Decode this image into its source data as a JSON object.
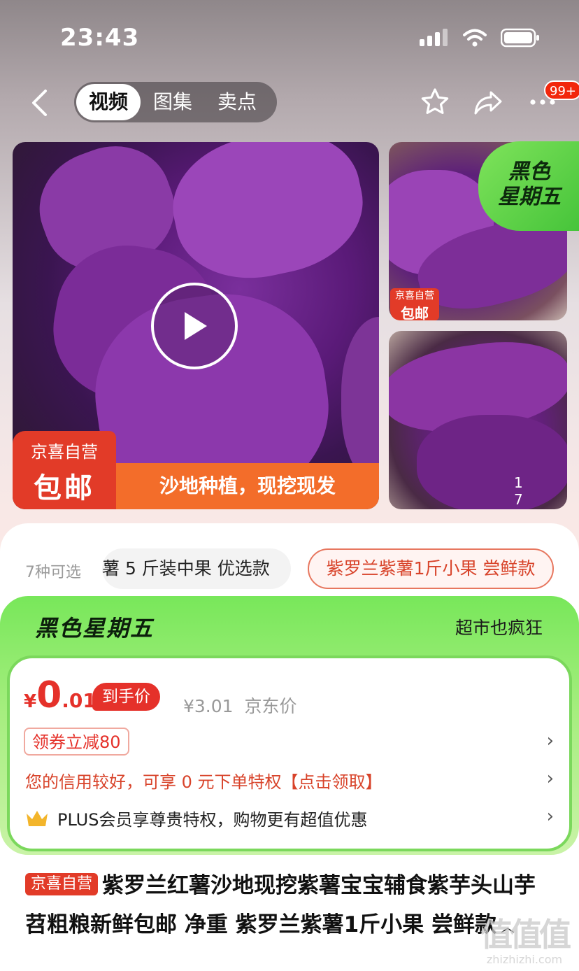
{
  "status_bar": {
    "time": "23:43"
  },
  "nav": {
    "tabs": [
      {
        "label": "视频",
        "active": true
      },
      {
        "label": "图集",
        "active": false
      },
      {
        "label": "卖点",
        "active": false
      }
    ],
    "badge": "99+"
  },
  "gallery": {
    "main_promo_top": "京喜自营",
    "main_promo_bottom": "包邮",
    "main_strip": "沙地种植，现挖现发",
    "side_tag": [
      "黑色",
      "星期五"
    ],
    "mini_promo_top": "京喜自营",
    "mini_promo_bottom": "包邮",
    "counter": "1 7"
  },
  "options": {
    "label": "7种可选",
    "chip1": "薯 5 斤装中果 优选款",
    "chip2": "紫罗兰紫薯1斤小果 尝鲜款"
  },
  "promo": {
    "title": "黑色星期五",
    "subtitle": "超市也疯狂"
  },
  "price": {
    "currency": "¥",
    "integer": "0",
    "decimal": ".01",
    "hand_price_label": "到手价",
    "jd_price": "¥3.01",
    "jd_price_label": "京东价",
    "coupon": "领券立减80",
    "credit": "您的信用较好，可享 0 元下单特权【点击领取】",
    "plus": "PLUS会员享尊贵特权，购物更有超值优惠"
  },
  "product": {
    "tag": "京喜自营",
    "title": "紫罗兰红薯沙地现挖紫薯宝宝辅食紫芋头山芋苕粗粮新鲜包邮 净重 紫罗兰紫薯1斤小果 尝鲜款"
  },
  "watermark": {
    "main": "值值值",
    "url": "zhizhizhi.com"
  },
  "colors": {
    "brand_red": "#e23b28",
    "price_red": "#e5312a",
    "promo_green": "#78e75a",
    "promo_orange": "#f36d2a"
  }
}
